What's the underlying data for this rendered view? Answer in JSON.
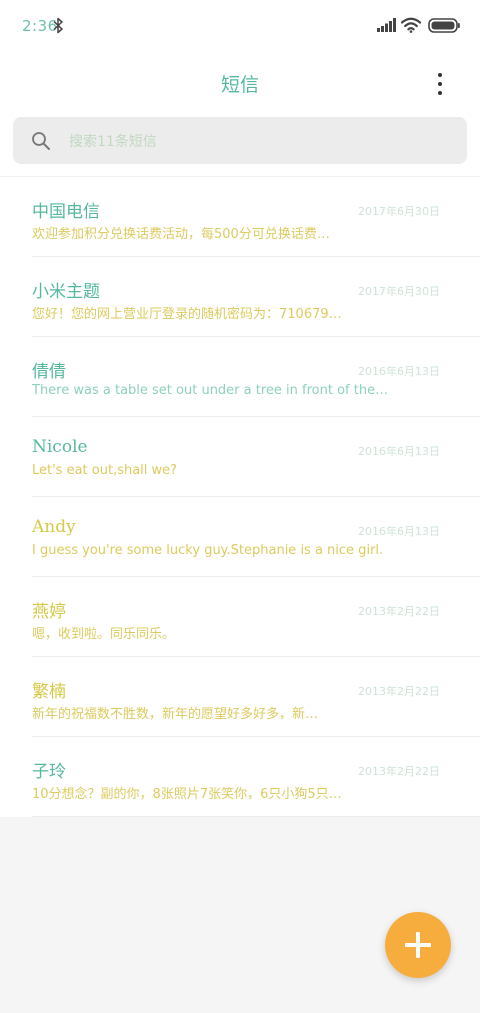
{
  "status_bar": {
    "time": "2:36",
    "icons": [
      "bluetooth-icon",
      "signal-icon",
      "wifi-icon",
      "battery-icon"
    ]
  },
  "header": {
    "title": "短信",
    "more_icon": "more-vertical-icon"
  },
  "search": {
    "placeholder": "搜索11条短信",
    "value": "",
    "icon": "search-icon"
  },
  "colors": {
    "accent": "#f7ac3e",
    "title": "#56b8a0",
    "name_green": "#56b8a0",
    "name_yellow": "#d6c94a",
    "preview_yellow": "#dccb5e",
    "preview_green": "#8fd0bf"
  },
  "conversations": [
    {
      "name": "中国电信",
      "time": "2017年6月30日",
      "preview": "欢迎参加积分兑换话费活动，每500分可兑换话费…",
      "name_color": "#56b8a0",
      "preview_color": "#dccb5e"
    },
    {
      "name": "小米主题",
      "time": "2017年6月30日",
      "preview": "您好！您的网上营业厅登录的随机密码为：710679…",
      "name_color": "#56b8a0",
      "preview_color": "#dccb5e"
    },
    {
      "name": "倩倩",
      "time": "2016年6月13日",
      "preview": "There was a table set out under a tree in front of the …",
      "name_color": "#56b8a0",
      "preview_color": "#8fd0bf"
    },
    {
      "name": "Nicole",
      "time": "2016年6月13日",
      "preview": "Let's eat out,shall we?",
      "name_color": "#56b8a0",
      "preview_color": "#dccb5e"
    },
    {
      "name": "Andy",
      "time": "2016年6月13日",
      "preview": "I guess you're some lucky guy.Stephanie is a nice girl.",
      "name_color": "#d6c94a",
      "preview_color": "#dccb5e"
    },
    {
      "name": "燕婷",
      "time": "2013年2月22日",
      "preview": "嗯，收到啦。同乐同乐。",
      "name_color": "#d6c94a",
      "preview_color": "#dccb5e"
    },
    {
      "name": "繁楠",
      "time": "2013年2月22日",
      "preview": "新年的祝福数不胜数，新年的愿望好多好多，新…",
      "name_color": "#d6c94a",
      "preview_color": "#dccb5e"
    },
    {
      "name": "子玲",
      "time": "2013年2月22日",
      "preview": "10分想念？副的你，8张照片7张笑你，6只小狗5只…",
      "name_color": "#56b8a0",
      "preview_color": "#dccb5e"
    }
  ],
  "fab": {
    "icon": "plus-icon",
    "color": "#f7ac3e"
  }
}
